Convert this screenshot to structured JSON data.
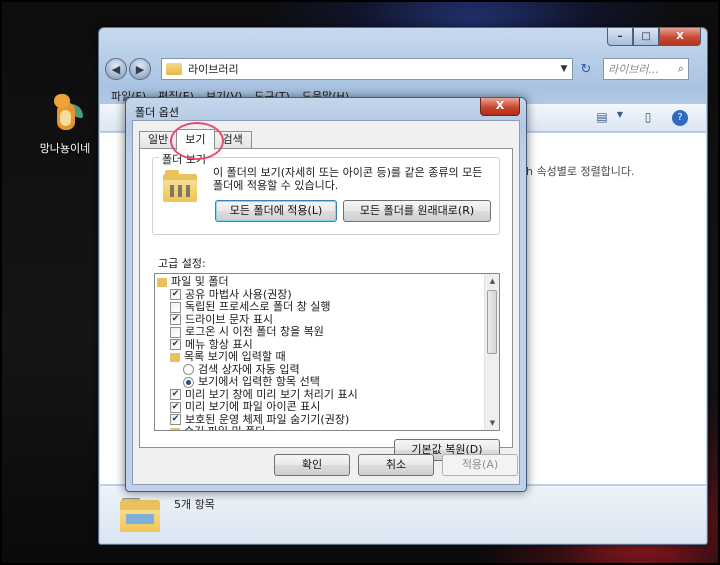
{
  "desktop": {
    "icon_label": "망나뇽이네"
  },
  "explorer": {
    "address": "라이브러리",
    "search_placeholder": "라이브러...",
    "menu": [
      "파일(F)",
      "편집(E)",
      "보기(V)",
      "도구(T)",
      "도움말(H)"
    ],
    "content_note": "h 속성별로 정렬합니다.",
    "status": "5개 항목",
    "window_buttons": {
      "minimize": "–",
      "maximize": "□",
      "close": "X"
    }
  },
  "dialog": {
    "title": "폴더 옵션",
    "close": "X",
    "tabs": [
      "일반",
      "보기",
      "검색"
    ],
    "group_title": "폴더 보기",
    "group_desc": "이 폴더의 보기(자세히 또는 아이콘 등)를 같은 종류의 모든 폴더에 적용할 수 있습니다.",
    "apply_all_button": "모든 폴더에 적용(L)",
    "reset_all_button": "모든 폴더를 원래대로(R)",
    "advanced_label": "고급 설정:",
    "restore_defaults_button": "기본값 복원(D)",
    "ok_button": "확인",
    "cancel_button": "취소",
    "apply_button": "적용(A)",
    "tree_items": [
      {
        "type": "folder",
        "label": "파일 및 폴더",
        "indent": 0
      },
      {
        "type": "checkbox",
        "label": "공유 마법사 사용(권장)",
        "checked": true,
        "indent": 1
      },
      {
        "type": "checkbox",
        "label": "독립된 프로세스로 폴더 창 실행",
        "checked": false,
        "indent": 1
      },
      {
        "type": "checkbox",
        "label": "드라이브 문자 표시",
        "checked": true,
        "indent": 1
      },
      {
        "type": "checkbox",
        "label": "로그온 시 이전 폴더 창을 복원",
        "checked": false,
        "indent": 1
      },
      {
        "type": "checkbox",
        "label": "메뉴 항상 표시",
        "checked": true,
        "indent": 1
      },
      {
        "type": "folder",
        "label": "목록 보기에 입력할 때",
        "indent": 1
      },
      {
        "type": "radio",
        "label": "검색 상자에 자동 입력",
        "checked": false,
        "indent": 2
      },
      {
        "type": "radio",
        "label": "보기에서 입력한 항목 선택",
        "checked": true,
        "indent": 2
      },
      {
        "type": "checkbox",
        "label": "미리 보기 창에 미리 보기 처리기 표시",
        "checked": true,
        "indent": 1
      },
      {
        "type": "checkbox",
        "label": "미리 보기에 파일 아이콘 표시",
        "checked": true,
        "indent": 1
      },
      {
        "type": "checkbox",
        "label": "보호된 운영 체제 파일 숨기기(권장)",
        "checked": true,
        "indent": 1
      },
      {
        "type": "folder",
        "label": "숨김 파일 및 폴더",
        "indent": 1
      }
    ]
  },
  "icons": {
    "back": "◀",
    "forward": "▶",
    "dropdown": "▼",
    "refresh": "↻",
    "search": "⌕",
    "check": "✔",
    "scroll_up": "▲",
    "scroll_down": "▼"
  }
}
